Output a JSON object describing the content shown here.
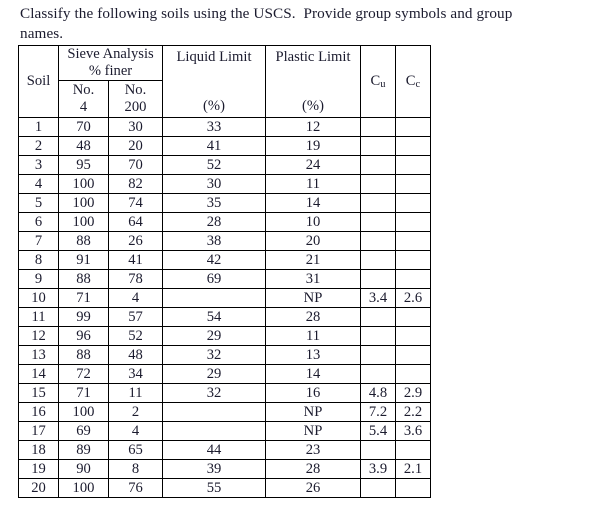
{
  "prompt": {
    "line1": "Classify the following soils using the USCS.  Provide group symbols and group",
    "line2": "names."
  },
  "table": {
    "headers": {
      "soil": "Soil",
      "sieve_analysis_l1": "Sieve Analysis",
      "sieve_analysis_l2": "% finer",
      "no4_l1": "No.",
      "no4_l2": "4",
      "no200_l1": "No.",
      "no200_l2": "200",
      "liquid_limit": "Liquid Limit",
      "liquid_limit_unit": "(%)",
      "plastic_limit": "Plastic Limit",
      "plastic_limit_unit": "(%)",
      "cu_base": "C",
      "cu_sub": "u",
      "cc_base": "C",
      "cc_sub": "c"
    },
    "rows": [
      {
        "soil": "1",
        "no4": "70",
        "no200": "30",
        "ll": "33",
        "pl": "12",
        "cu": "",
        "cc": ""
      },
      {
        "soil": "2",
        "no4": "48",
        "no200": "20",
        "ll": "41",
        "pl": "19",
        "cu": "",
        "cc": ""
      },
      {
        "soil": "3",
        "no4": "95",
        "no200": "70",
        "ll": "52",
        "pl": "24",
        "cu": "",
        "cc": ""
      },
      {
        "soil": "4",
        "no4": "100",
        "no200": "82",
        "ll": "30",
        "pl": "11",
        "cu": "",
        "cc": ""
      },
      {
        "soil": "5",
        "no4": "100",
        "no200": "74",
        "ll": "35",
        "pl": "14",
        "cu": "",
        "cc": ""
      },
      {
        "soil": "6",
        "no4": "100",
        "no200": "64",
        "ll": "28",
        "pl": "10",
        "cu": "",
        "cc": ""
      },
      {
        "soil": "7",
        "no4": "88",
        "no200": "26",
        "ll": "38",
        "pl": "20",
        "cu": "",
        "cc": ""
      },
      {
        "soil": "8",
        "no4": "91",
        "no200": "41",
        "ll": "42",
        "pl": "21",
        "cu": "",
        "cc": ""
      },
      {
        "soil": "9",
        "no4": "88",
        "no200": "78",
        "ll": "69",
        "pl": "31",
        "cu": "",
        "cc": ""
      },
      {
        "soil": "10",
        "no4": "71",
        "no200": "4",
        "ll": "",
        "pl": "NP",
        "cu": "3.4",
        "cc": "2.6"
      },
      {
        "soil": "11",
        "no4": "99",
        "no200": "57",
        "ll": "54",
        "pl": "28",
        "cu": "",
        "cc": ""
      },
      {
        "soil": "12",
        "no4": "96",
        "no200": "52",
        "ll": "29",
        "pl": "11",
        "cu": "",
        "cc": ""
      },
      {
        "soil": "13",
        "no4": "88",
        "no200": "48",
        "ll": "32",
        "pl": "13",
        "cu": "",
        "cc": ""
      },
      {
        "soil": "14",
        "no4": "72",
        "no200": "34",
        "ll": "29",
        "pl": "14",
        "cu": "",
        "cc": ""
      },
      {
        "soil": "15",
        "no4": "71",
        "no200": "11",
        "ll": "32",
        "pl": "16",
        "cu": "4.8",
        "cc": "2.9"
      },
      {
        "soil": "16",
        "no4": "100",
        "no200": "2",
        "ll": "",
        "pl": "NP",
        "cu": "7.2",
        "cc": "2.2"
      },
      {
        "soil": "17",
        "no4": "69",
        "no200": "4",
        "ll": "",
        "pl": "NP",
        "cu": "5.4",
        "cc": "3.6"
      },
      {
        "soil": "18",
        "no4": "89",
        "no200": "65",
        "ll": "44",
        "pl": "23",
        "cu": "",
        "cc": ""
      },
      {
        "soil": "19",
        "no4": "90",
        "no200": "8",
        "ll": "39",
        "pl": "28",
        "cu": "3.9",
        "cc": "2.1"
      },
      {
        "soil": "20",
        "no4": "100",
        "no200": "76",
        "ll": "55",
        "pl": "26",
        "cu": "",
        "cc": ""
      }
    ]
  },
  "colors": {
    "text": "#1b1b2e",
    "border": "#000000",
    "background": "#ffffff"
  }
}
